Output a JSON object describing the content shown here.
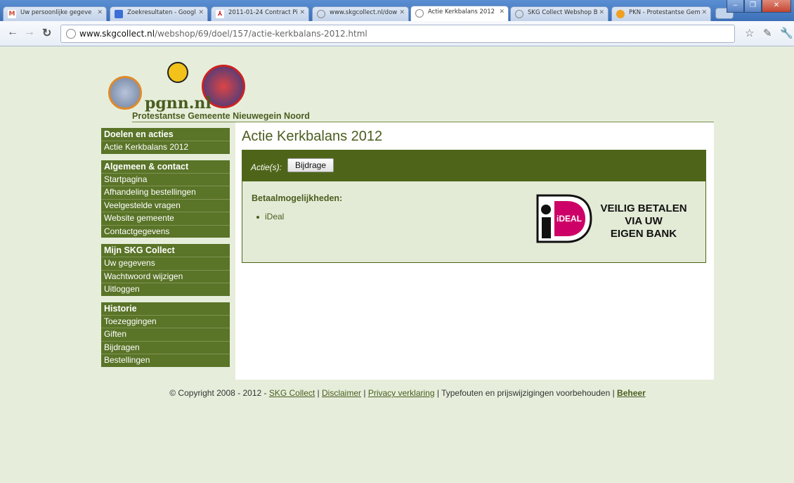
{
  "browser": {
    "tabs": [
      {
        "label": "Uw persoonlijke gegeve",
        "icon": "gmail-icon",
        "color": "#d14836"
      },
      {
        "label": "Zoekresultaten - Googl",
        "icon": "docs-icon",
        "color": "#3b6fd6"
      },
      {
        "label": "2011-01-24 Contract Pi",
        "icon": "pdf-icon",
        "color": "#d02020"
      },
      {
        "label": "www.skgcollect.nl/dow",
        "icon": "globe-icon",
        "color": "#888888"
      },
      {
        "label": "Actie Kerkbalans 2012",
        "icon": "globe-icon",
        "color": "#888888"
      },
      {
        "label": "SKG Collect Webshop B",
        "icon": "globe-icon",
        "color": "#888888"
      },
      {
        "label": "PKN - Protestantse Gem",
        "icon": "pkn-icon",
        "color": "#f0a020"
      }
    ],
    "url_host": "www.skgcollect.nl",
    "url_path": "/webshop/69/doel/157/actie-kerkbalans-2012.html"
  },
  "header": {
    "logo_text": "pgnn.nl",
    "subtitle": "Protestantse Gemeente Nieuwegein Noord"
  },
  "sidebar": {
    "groups": [
      {
        "title": "Doelen en acties",
        "items": [
          "Actie Kerkbalans 2012"
        ]
      },
      {
        "title": "Algemeen & contact",
        "items": [
          "Startpagina",
          "Afhandeling bestellingen",
          "Veelgestelde vragen",
          "Website gemeente",
          "Contactgegevens"
        ]
      },
      {
        "title": "Mijn SKG Collect",
        "items": [
          "Uw gegevens",
          "Wachtwoord wijzigen",
          "Uitloggen"
        ]
      },
      {
        "title": "Historie",
        "items": [
          "Toezeggingen",
          "Giften",
          "Bijdragen",
          "Bestellingen"
        ]
      }
    ]
  },
  "main": {
    "title": "Actie Kerkbalans 2012",
    "actions_label": "Actie(s):",
    "action_button": "Bijdrage",
    "payment_heading": "Betaalmogelijkheden:",
    "payment_methods": [
      "iDeal"
    ],
    "ideal_logo_text": "iDEAL",
    "promo_line1": "VEILIG BETALEN",
    "promo_line2": "VIA UW",
    "promo_line3": "EIGEN BANK"
  },
  "footer": {
    "copyright": "© Copyright 2008 - 2012 - ",
    "link_skg": "SKG Collect",
    "sep1": " | ",
    "link_disclaimer": "Disclaimer",
    "sep2": " | ",
    "link_privacy": "Privacy verklaring",
    "notice": " | Typefouten en prijswijzigingen voorbehouden | ",
    "link_beheer": "Beheer"
  },
  "colors": {
    "page_bg": "#e6eedb",
    "brand_green": "#5a7428",
    "dark_green": "#4e6519",
    "ideal_pink": "#cc0066"
  }
}
